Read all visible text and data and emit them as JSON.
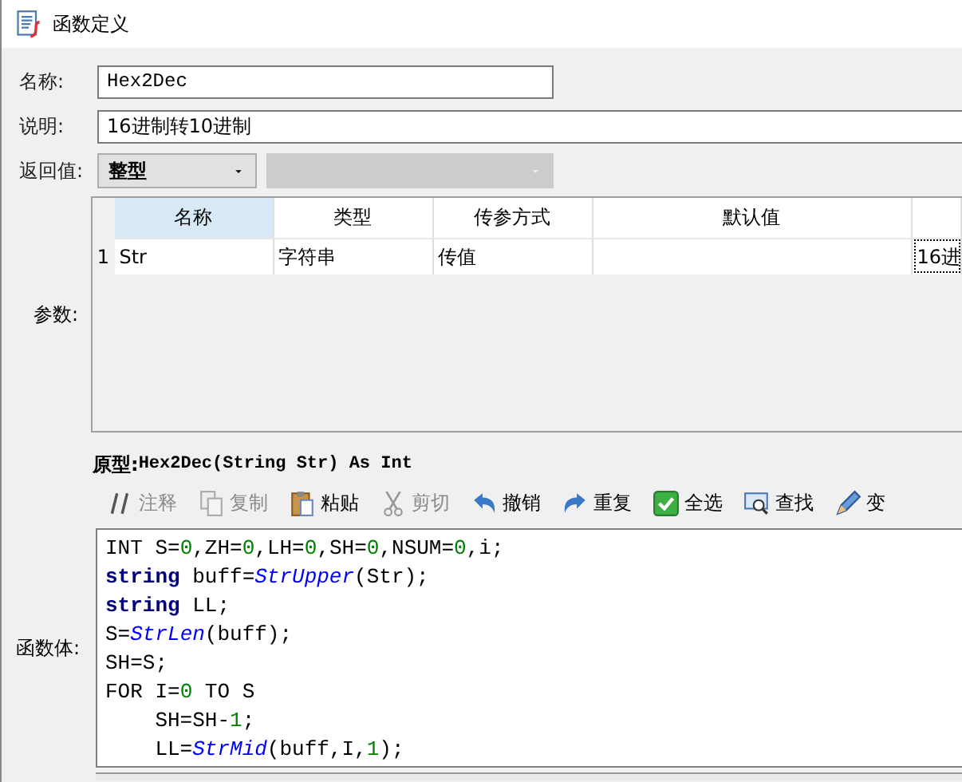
{
  "window": {
    "title": "函数定义"
  },
  "form": {
    "name_label": "名称:",
    "name_value": "Hex2Dec",
    "desc_label": "说明:",
    "desc_value": "16进制转10进制",
    "return_label": "返回值:",
    "return_value": "整型",
    "return_sub_disabled": true
  },
  "params": {
    "label": "参数:",
    "columns": [
      {
        "label": "名称",
        "selected": true
      },
      {
        "label": "类型",
        "selected": false
      },
      {
        "label": "传参方式",
        "selected": false
      },
      {
        "label": "默认值",
        "selected": false
      }
    ],
    "rows": [
      {
        "number": "1",
        "cells": [
          "Str",
          "字符串",
          "传值"
        ],
        "column_5": "16进"
      }
    ]
  },
  "prototype": {
    "label": "原型:",
    "value": "Hex2Dec(String Str) As Int"
  },
  "toolbar": [
    {
      "kind": "comment",
      "label": "注释",
      "disabled": true
    },
    {
      "kind": "copy",
      "label": "复制",
      "disabled": true
    },
    {
      "kind": "paste",
      "label": "粘贴",
      "disabled": false
    },
    {
      "kind": "cut",
      "label": "剪切",
      "disabled": true
    },
    {
      "kind": "undo",
      "label": "撤销",
      "disabled": false
    },
    {
      "kind": "redo",
      "label": "重复",
      "disabled": false
    },
    {
      "kind": "selectall",
      "label": "全选",
      "disabled": false
    },
    {
      "kind": "find",
      "label": "查找",
      "disabled": false
    },
    {
      "kind": "replace",
      "label": "变",
      "disabled": false
    }
  ],
  "body": {
    "label": "函数体:",
    "lines": [
      [
        {
          "kind": "plain",
          "text": "INT S="
        },
        {
          "kind": "num",
          "text": "0"
        },
        {
          "kind": "plain",
          "text": ",ZH="
        },
        {
          "kind": "num",
          "text": "0"
        },
        {
          "kind": "plain",
          "text": ",LH="
        },
        {
          "kind": "num",
          "text": "0"
        },
        {
          "kind": "plain",
          "text": ",SH="
        },
        {
          "kind": "num",
          "text": "0"
        },
        {
          "kind": "plain",
          "text": ",NSUM="
        },
        {
          "kind": "num",
          "text": "0"
        },
        {
          "kind": "plain",
          "text": ",i;"
        }
      ],
      [
        {
          "kind": "keyword",
          "text": "string"
        },
        {
          "kind": "plain",
          "text": " buff="
        },
        {
          "kind": "func",
          "text": "StrUpper"
        },
        {
          "kind": "plain",
          "text": "(Str);"
        }
      ],
      [
        {
          "kind": "keyword",
          "text": "string"
        },
        {
          "kind": "plain",
          "text": " LL;"
        }
      ],
      [
        {
          "kind": "plain",
          "text": "S="
        },
        {
          "kind": "func",
          "text": "StrLen"
        },
        {
          "kind": "plain",
          "text": "(buff);"
        }
      ],
      [
        {
          "kind": "plain",
          "text": "SH=S;"
        }
      ],
      [
        {
          "kind": "plain",
          "text": "FOR I="
        },
        {
          "kind": "num",
          "text": "0"
        },
        {
          "kind": "plain",
          "text": " TO S"
        }
      ],
      [
        {
          "kind": "plain",
          "text": "    SH=SH-"
        },
        {
          "kind": "num",
          "text": "1"
        },
        {
          "kind": "plain",
          "text": ";"
        }
      ],
      [
        {
          "kind": "plain",
          "text": "    LL="
        },
        {
          "kind": "func",
          "text": "StrMid"
        },
        {
          "kind": "plain",
          "text": "(buff,I,"
        },
        {
          "kind": "num",
          "text": "1"
        },
        {
          "kind": "plain",
          "text": ");"
        }
      ]
    ]
  }
}
